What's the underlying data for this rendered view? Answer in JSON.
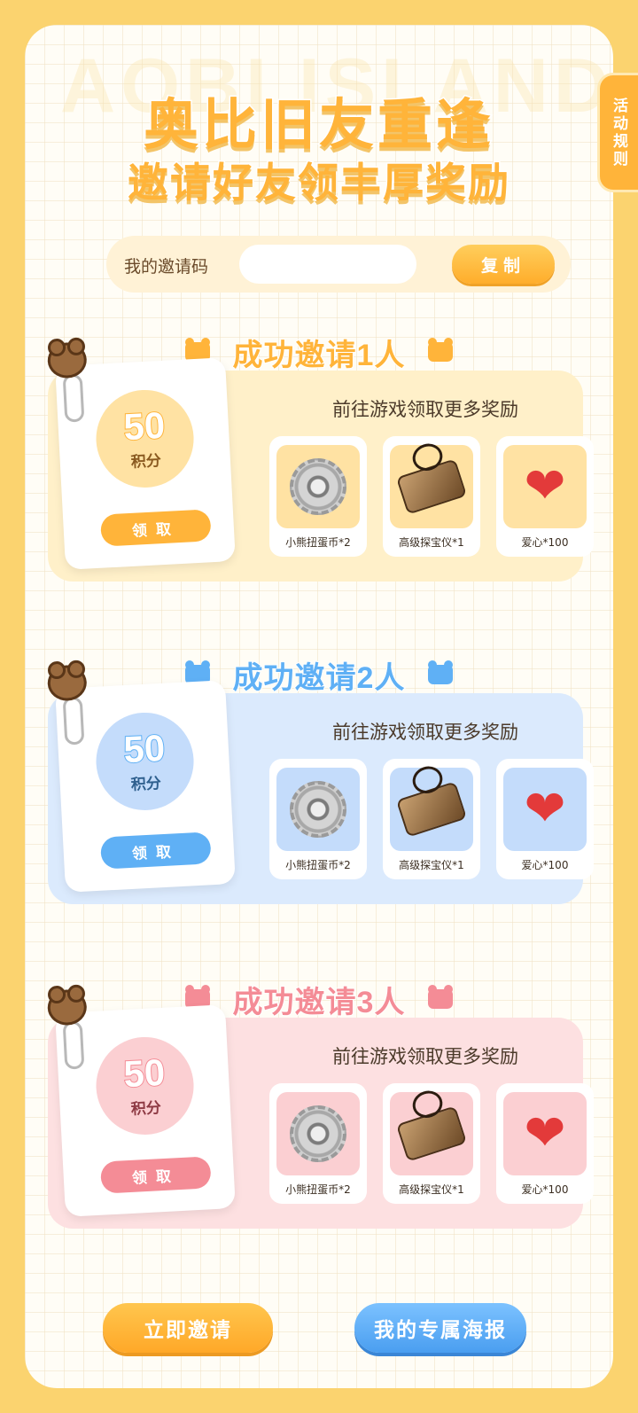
{
  "header": {
    "title": "奥比旧友重逢",
    "subtitle": "邀请好友领丰厚奖励",
    "watermark": "AOBI ISLAND"
  },
  "rules_tab": {
    "label": "活动规则"
  },
  "invite": {
    "label": "我的邀请码",
    "code_value": "",
    "copy_label": "复制"
  },
  "tiers": [
    {
      "heading": "成功邀请1人",
      "points": "50",
      "points_unit": "积分",
      "claim_label": "领取",
      "rewards_title": "前往游戏领取更多奖励",
      "rewards": [
        {
          "name": "小熊扭蛋币*2",
          "icon": "gear-coin-icon"
        },
        {
          "name": "高级探宝仪*1",
          "icon": "treasure-detector-icon"
        },
        {
          "name": "爱心*100",
          "icon": "heart-icon"
        }
      ],
      "colors": {
        "accent": "#ffb43a",
        "light": "#fff0c9",
        "circle": "#ffe2a3",
        "title": "#ffb43a"
      }
    },
    {
      "heading": "成功邀请2人",
      "points": "50",
      "points_unit": "积分",
      "claim_label": "领取",
      "rewards_title": "前往游戏领取更多奖励",
      "rewards": [
        {
          "name": "小熊扭蛋币*2",
          "icon": "gear-coin-icon"
        },
        {
          "name": "高级探宝仪*1",
          "icon": "treasure-detector-icon"
        },
        {
          "name": "爱心*100",
          "icon": "heart-icon"
        }
      ],
      "colors": {
        "accent": "#5fb0f5",
        "light": "#dbeafd",
        "circle": "#c4dcfb",
        "title": "#5fb0f5"
      }
    },
    {
      "heading": "成功邀请3人",
      "points": "50",
      "points_unit": "积分",
      "claim_label": "领取",
      "rewards_title": "前往游戏领取更多奖励",
      "rewards": [
        {
          "name": "小熊扭蛋币*2",
          "icon": "gear-coin-icon"
        },
        {
          "name": "高级探宝仪*1",
          "icon": "treasure-detector-icon"
        },
        {
          "name": "爱心*100",
          "icon": "heart-icon"
        }
      ],
      "colors": {
        "accent": "#f48c96",
        "light": "#fde0e1",
        "circle": "#fbcfd2",
        "title": "#f48c96"
      }
    }
  ],
  "footer": {
    "invite_now_label": "立即邀请",
    "poster_label": "我的专属海报",
    "colors": {
      "invite_now": "#ffb43a",
      "poster": "#5fb0f5"
    }
  }
}
